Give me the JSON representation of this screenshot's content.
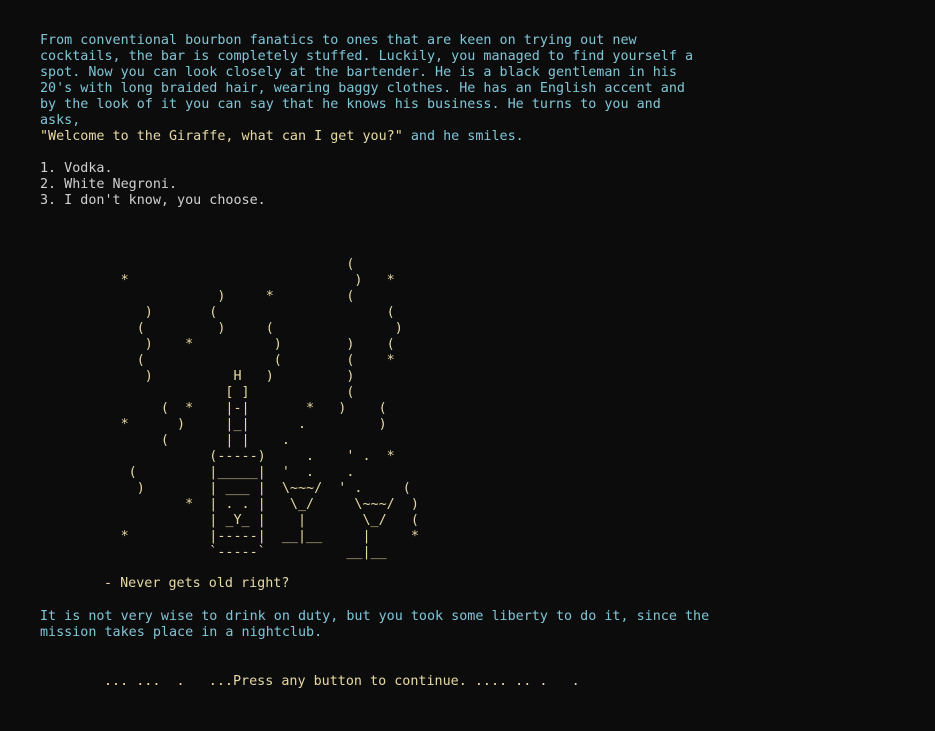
{
  "narration": {
    "lines": [
      "From conventional bourbon fanatics to ones that are keen on trying out new",
      "cocktails, the bar is completely stuffed. Luckily, you managed to find yourself a",
      "spot. Now you can look closely at the bartender. He is a black gentleman in his",
      "20's with long braided hair, wearing baggy clothes. He has an English accent and",
      "by the look of it you can say that he knows his business. He turns to you and",
      "asks,"
    ],
    "dialogue": "\"Welcome to the Giraffe, what can I get you?\"",
    "dialogue_suffix": " and he smiles."
  },
  "options": [
    "1. Vodka.",
    "2. White Negroni.",
    "3. I don't know, you choose."
  ],
  "ascii_art": "                                      (\n          *                            )   *\n                      )     *         (\n             )       (                     (\n            (         )     (               )\n             )    *          )        )    (\n            (                (        (    *\n             )          H   )         )\n                       [ ]            (\n               (  *    |-|       *   )    (\n          *      )     |_|      .         )\n               (       | |    .\n                     (-----)     .    ' .  *\n           (         |_____|  '  .    .\n            )        | ___ |  \\~~~/  ' .     (\n                  *  | . . |   \\_/     \\~~~/  )\n                     | _Y_ |    |       \\_/   (\n          *          |-----|  __|__     |     *\n                     `-----`          __|__",
  "quote": "- Never gets old right?",
  "closing": [
    "It is not very wise to drink on duty, but you took some liberty to do it, since the",
    "mission takes place in a nightclub."
  ],
  "continue_prompt": "... ...  .   ...Press any button to continue. .... .. .   ."
}
